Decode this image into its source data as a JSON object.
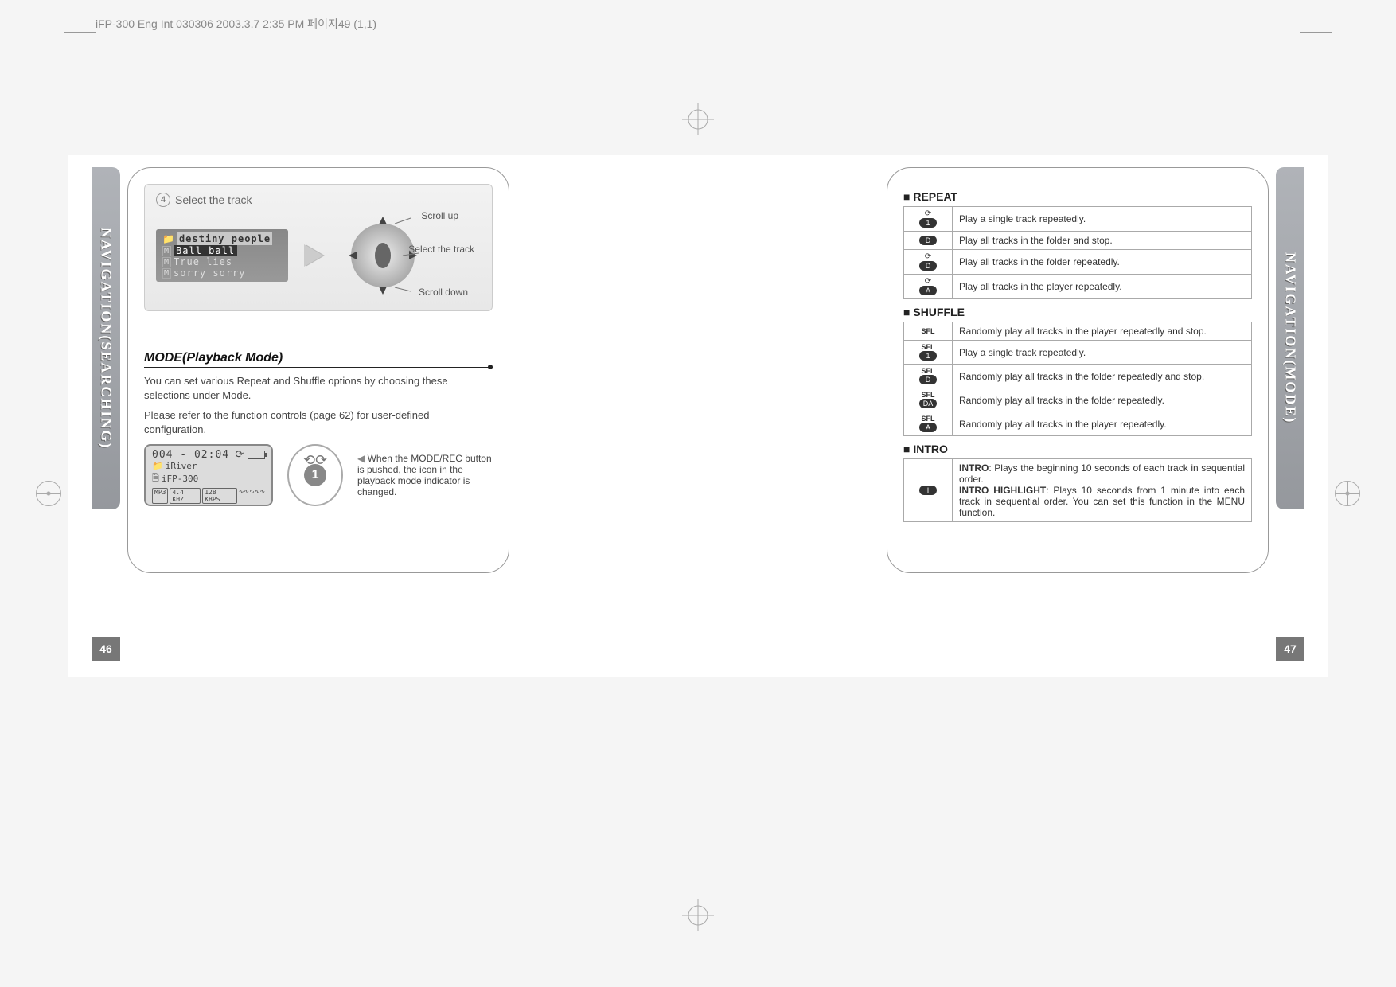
{
  "filepath": "iFP-300 Eng Int 030306  2003.3.7 2:35 PM  페이지49 (1,1)",
  "left": {
    "tab": "NAVIGATION(SEARCHING)",
    "pagenum": "46",
    "step": {
      "num": "4",
      "title": "Select the track",
      "tracks": {
        "folder": "destiny people",
        "t1": "Ball ball",
        "t2": "True lies",
        "t3": "sorry sorry"
      },
      "joystick": {
        "up": "Scroll up",
        "select": "Select the track",
        "down": "Scroll down"
      }
    },
    "section_title": "MODE(Playback Mode)",
    "body1": "You can set various Repeat and Shuffle options by choosing these selections under Mode.",
    "body2": "Please refer to the function controls (page 62) for user-defined configuration.",
    "lcd": {
      "counter": "004",
      "time": "02:04",
      "folder": "iRiver",
      "file": "iFP-300",
      "tag1": "MP3",
      "tag2": "4.4 KHZ",
      "tag3": "128 KBPS"
    },
    "mode_note": "When the MODE/REC button is pushed, the icon in the playback mode indicator is changed.",
    "mode_num": "1"
  },
  "right": {
    "tab": "NAVIGATION(MODE)",
    "pagenum": "47",
    "repeat": {
      "title": "REPEAT",
      "rows": [
        {
          "icon": "1",
          "desc": "Play a single track repeatedly."
        },
        {
          "icon": "D",
          "desc": "Play all tracks in the folder and stop."
        },
        {
          "icon": "D",
          "desc": "Play all tracks in the folder repeatedly.",
          "loop": true
        },
        {
          "icon": "A",
          "desc": "Play all tracks in the player repeatedly.",
          "loop": true
        }
      ]
    },
    "shuffle": {
      "title": "SHUFFLE",
      "rows": [
        {
          "icon": "",
          "desc": "Randomly play all tracks in the player repeatedly and stop."
        },
        {
          "icon": "1",
          "desc": "Play a single track repeatedly."
        },
        {
          "icon": "D",
          "desc": "Randomly play all tracks in the folder repeatedly and stop."
        },
        {
          "icon": "DA",
          "desc": "Randomly play all tracks in the folder repeatedly."
        },
        {
          "icon": "A",
          "desc": "Randomly play all tracks in the player repeatedly."
        }
      ]
    },
    "intro": {
      "title": "INTRO",
      "icon": "I",
      "desc_label1": "INTRO",
      "desc1": ": Plays the beginning 10 seconds of each track in sequential order.",
      "desc_label2": "INTRO HIGHLIGHT",
      "desc2": ": Plays 10 seconds from 1 minute into each track in sequential order. You can set this function in the MENU function."
    }
  }
}
